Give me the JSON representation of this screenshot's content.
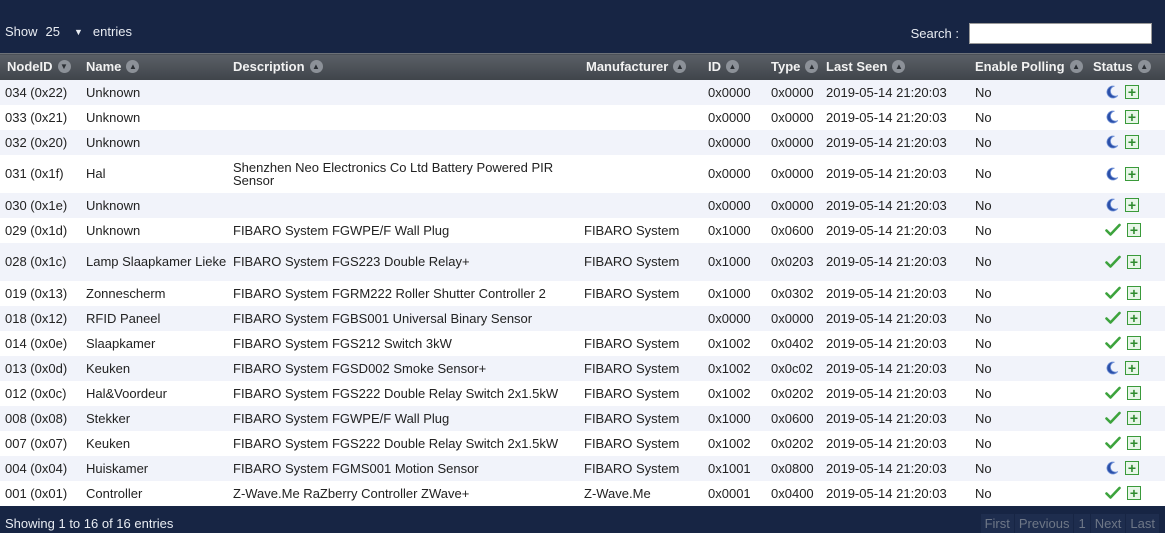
{
  "controls": {
    "show_label": "Show",
    "page_size": "25",
    "entries_label": "entries",
    "search_label": "Search :",
    "search_value": ""
  },
  "columns": [
    "NodeID",
    "Name",
    "Description",
    "Manufacturer",
    "ID",
    "Type",
    "Last Seen",
    "Enable Polling",
    "Status"
  ],
  "rows": [
    {
      "node": "034 (0x22)",
      "name": "Unknown",
      "desc": "",
      "mfr": "",
      "id": "0x0000",
      "type": "0x0000",
      "seen": "2019-05-14 21:20:03",
      "poll": "No",
      "status": "sleep"
    },
    {
      "node": "033 (0x21)",
      "name": "Unknown",
      "desc": "",
      "mfr": "",
      "id": "0x0000",
      "type": "0x0000",
      "seen": "2019-05-14 21:20:03",
      "poll": "No",
      "status": "sleep"
    },
    {
      "node": "032 (0x20)",
      "name": "Unknown",
      "desc": "",
      "mfr": "",
      "id": "0x0000",
      "type": "0x0000",
      "seen": "2019-05-14 21:20:03",
      "poll": "No",
      "status": "sleep"
    },
    {
      "node": "031 (0x1f)",
      "name": "Hal",
      "desc": "Shenzhen Neo Electronics Co Ltd Battery Powered PIR Sensor",
      "mfr": "",
      "id": "0x0000",
      "type": "0x0000",
      "seen": "2019-05-14 21:20:03",
      "poll": "No",
      "status": "sleep"
    },
    {
      "node": "030 (0x1e)",
      "name": "Unknown",
      "desc": "",
      "mfr": "",
      "id": "0x0000",
      "type": "0x0000",
      "seen": "2019-05-14 21:20:03",
      "poll": "No",
      "status": "sleep"
    },
    {
      "node": "029 (0x1d)",
      "name": "Unknown",
      "desc": "FIBARO System FGWPE/F Wall Plug",
      "mfr": "FIBARO System",
      "id": "0x1000",
      "type": "0x0600",
      "seen": "2019-05-14 21:20:03",
      "poll": "No",
      "status": "ok"
    },
    {
      "node": "028 (0x1c)",
      "name": "Lamp Slaapkamer Lieke",
      "desc": "FIBARO System FGS223 Double Relay+",
      "mfr": "FIBARO System",
      "id": "0x1000",
      "type": "0x0203",
      "seen": "2019-05-14 21:20:03",
      "poll": "No",
      "status": "ok"
    },
    {
      "node": "019 (0x13)",
      "name": "Zonnescherm",
      "desc": "FIBARO System FGRM222 Roller Shutter Controller 2",
      "mfr": "FIBARO System",
      "id": "0x1000",
      "type": "0x0302",
      "seen": "2019-05-14 21:20:03",
      "poll": "No",
      "status": "ok"
    },
    {
      "node": "018 (0x12)",
      "name": "RFID Paneel",
      "desc": "FIBARO System FGBS001 Universal Binary Sensor",
      "mfr": "",
      "id": "0x0000",
      "type": "0x0000",
      "seen": "2019-05-14 21:20:03",
      "poll": "No",
      "status": "ok"
    },
    {
      "node": "014 (0x0e)",
      "name": "Slaapkamer",
      "desc": "FIBARO System FGS212 Switch 3kW",
      "mfr": "FIBARO System",
      "id": "0x1002",
      "type": "0x0402",
      "seen": "2019-05-14 21:20:03",
      "poll": "No",
      "status": "ok"
    },
    {
      "node": "013 (0x0d)",
      "name": "Keuken",
      "desc": "FIBARO System FGSD002 Smoke Sensor+",
      "mfr": "FIBARO System",
      "id": "0x1002",
      "type": "0x0c02",
      "seen": "2019-05-14 21:20:03",
      "poll": "No",
      "status": "sleep"
    },
    {
      "node": "012 (0x0c)",
      "name": "Hal&Voordeur",
      "desc": "FIBARO System FGS222 Double Relay Switch 2x1.5kW",
      "mfr": "FIBARO System",
      "id": "0x1002",
      "type": "0x0202",
      "seen": "2019-05-14 21:20:03",
      "poll": "No",
      "status": "ok"
    },
    {
      "node": "008 (0x08)",
      "name": "Stekker",
      "desc": "FIBARO System FGWPE/F Wall Plug",
      "mfr": "FIBARO System",
      "id": "0x1000",
      "type": "0x0600",
      "seen": "2019-05-14 21:20:03",
      "poll": "No",
      "status": "ok"
    },
    {
      "node": "007 (0x07)",
      "name": "Keuken",
      "desc": "FIBARO System FGS222 Double Relay Switch 2x1.5kW",
      "mfr": "FIBARO System",
      "id": "0x1002",
      "type": "0x0202",
      "seen": "2019-05-14 21:20:03",
      "poll": "No",
      "status": "ok"
    },
    {
      "node": "004 (0x04)",
      "name": "Huiskamer",
      "desc": "FIBARO System FGMS001 Motion Sensor",
      "mfr": "FIBARO System",
      "id": "0x1001",
      "type": "0x0800",
      "seen": "2019-05-14 21:20:03",
      "poll": "No",
      "status": "sleep"
    },
    {
      "node": "001 (0x01)",
      "name": "Controller",
      "desc": "Z-Wave.Me RaZberry Controller ZWave+",
      "mfr": "Z-Wave.Me",
      "id": "0x0001",
      "type": "0x0400",
      "seen": "2019-05-14 21:20:03",
      "poll": "No",
      "status": "ok"
    }
  ],
  "footer": {
    "info": "Showing 1 to 16 of 16 entries",
    "pager": [
      "First",
      "Previous",
      "1",
      "Next",
      "Last"
    ]
  },
  "colors": {
    "header_bg": "#172544",
    "table_header": "#4a4f55",
    "row_alt": "#f1f3fa",
    "ok_green": "#3da33d",
    "sleep_blue": "#2b4fa8"
  },
  "icons": {
    "sort": "sort-icon",
    "ok": "check-icon",
    "sleep": "moon-icon",
    "add": "plus-icon"
  }
}
